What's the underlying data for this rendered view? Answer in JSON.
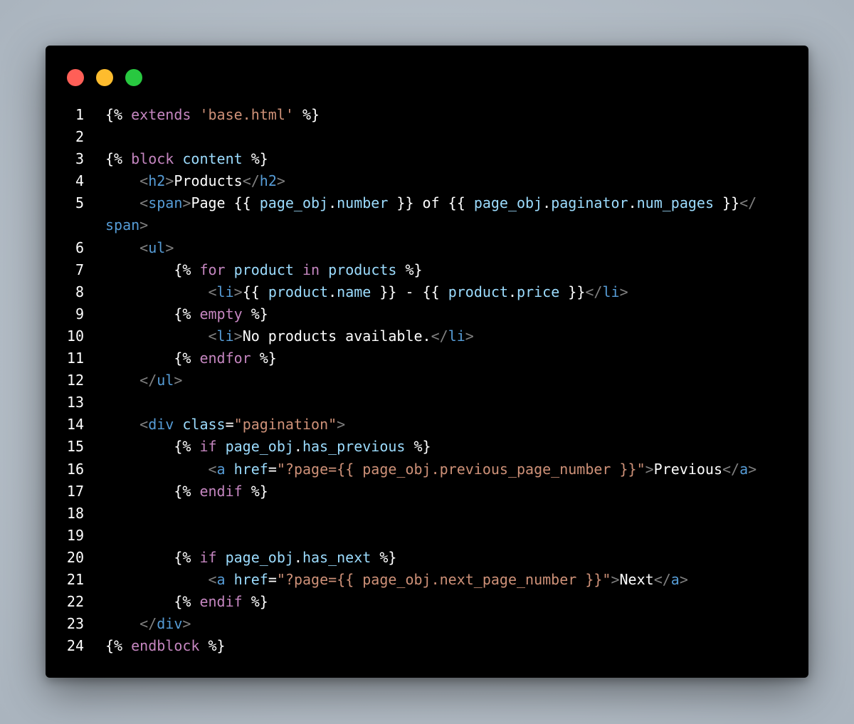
{
  "window": {
    "controls": [
      {
        "name": "close",
        "color": "#ff5f57"
      },
      {
        "name": "minimize",
        "color": "#febc2e"
      },
      {
        "name": "maximize",
        "color": "#28c840"
      }
    ]
  },
  "code": {
    "language": "django-html",
    "colors": {
      "text": "#ffffff",
      "keyword": "#c586c0",
      "string": "#ce9178",
      "variable": "#9cdcfe",
      "tag": "#569cd6",
      "punctuation": "#808080"
    },
    "lines": [
      {
        "number": "1",
        "segments": [
          [
            "w",
            "{% "
          ],
          [
            "kw",
            "extends"
          ],
          [
            "w",
            " "
          ],
          [
            "s",
            "'base.html'"
          ],
          [
            "w",
            " %}"
          ]
        ]
      },
      {
        "number": "2",
        "segments": []
      },
      {
        "number": "3",
        "segments": [
          [
            "w",
            "{% "
          ],
          [
            "kw",
            "block"
          ],
          [
            "w",
            " "
          ],
          [
            "v",
            "content"
          ],
          [
            "w",
            " %}"
          ]
        ]
      },
      {
        "number": "4",
        "segments": [
          [
            "w",
            "    "
          ],
          [
            "g",
            "<"
          ],
          [
            "t",
            "h2"
          ],
          [
            "g",
            ">"
          ],
          [
            "w",
            "Products"
          ],
          [
            "g",
            "</"
          ],
          [
            "t",
            "h2"
          ],
          [
            "g",
            ">"
          ]
        ]
      },
      {
        "number": "5",
        "segments": [
          [
            "w",
            "    "
          ],
          [
            "g",
            "<"
          ],
          [
            "t",
            "span"
          ],
          [
            "g",
            ">"
          ],
          [
            "w",
            "Page {{ "
          ],
          [
            "v",
            "page_obj"
          ],
          [
            "w",
            "."
          ],
          [
            "v",
            "number"
          ],
          [
            "w",
            " }} of {{ "
          ],
          [
            "v",
            "page_obj"
          ],
          [
            "w",
            "."
          ],
          [
            "v",
            "paginator"
          ],
          [
            "w",
            "."
          ],
          [
            "v",
            "num_pages"
          ],
          [
            "w",
            " }}"
          ],
          [
            "g",
            "</"
          ]
        ],
        "continuation": [
          [
            "t",
            "span"
          ],
          [
            "g",
            ">"
          ]
        ]
      },
      {
        "number": "6",
        "segments": [
          [
            "w",
            "    "
          ],
          [
            "g",
            "<"
          ],
          [
            "t",
            "ul"
          ],
          [
            "g",
            ">"
          ]
        ]
      },
      {
        "number": "7",
        "segments": [
          [
            "w",
            "        {% "
          ],
          [
            "kw",
            "for"
          ],
          [
            "w",
            " "
          ],
          [
            "v",
            "product"
          ],
          [
            "w",
            " "
          ],
          [
            "kw",
            "in"
          ],
          [
            "w",
            " "
          ],
          [
            "v",
            "products"
          ],
          [
            "w",
            " %}"
          ]
        ]
      },
      {
        "number": "8",
        "segments": [
          [
            "w",
            "            "
          ],
          [
            "g",
            "<"
          ],
          [
            "t",
            "li"
          ],
          [
            "g",
            ">"
          ],
          [
            "w",
            "{{ "
          ],
          [
            "v",
            "product"
          ],
          [
            "w",
            "."
          ],
          [
            "v",
            "name"
          ],
          [
            "w",
            " }} - {{ "
          ],
          [
            "v",
            "product"
          ],
          [
            "w",
            "."
          ],
          [
            "v",
            "price"
          ],
          [
            "w",
            " }}"
          ],
          [
            "g",
            "</"
          ],
          [
            "t",
            "li"
          ],
          [
            "g",
            ">"
          ]
        ]
      },
      {
        "number": "9",
        "segments": [
          [
            "w",
            "        {% "
          ],
          [
            "kw",
            "empty"
          ],
          [
            "w",
            " %}"
          ]
        ]
      },
      {
        "number": "10",
        "segments": [
          [
            "w",
            "            "
          ],
          [
            "g",
            "<"
          ],
          [
            "t",
            "li"
          ],
          [
            "g",
            ">"
          ],
          [
            "w",
            "No products available."
          ],
          [
            "g",
            "</"
          ],
          [
            "t",
            "li"
          ],
          [
            "g",
            ">"
          ]
        ]
      },
      {
        "number": "11",
        "segments": [
          [
            "w",
            "        {% "
          ],
          [
            "kw",
            "endfor"
          ],
          [
            "w",
            " %}"
          ]
        ]
      },
      {
        "number": "12",
        "segments": [
          [
            "w",
            "    "
          ],
          [
            "g",
            "</"
          ],
          [
            "t",
            "ul"
          ],
          [
            "g",
            ">"
          ]
        ]
      },
      {
        "number": "13",
        "segments": []
      },
      {
        "number": "14",
        "segments": [
          [
            "w",
            "    "
          ],
          [
            "g",
            "<"
          ],
          [
            "t",
            "div"
          ],
          [
            "w",
            " "
          ],
          [
            "v",
            "class"
          ],
          [
            "w",
            "="
          ],
          [
            "s",
            "\"pagination\""
          ],
          [
            "g",
            ">"
          ]
        ]
      },
      {
        "number": "15",
        "segments": [
          [
            "w",
            "        {% "
          ],
          [
            "kw",
            "if"
          ],
          [
            "w",
            " "
          ],
          [
            "v",
            "page_obj"
          ],
          [
            "w",
            "."
          ],
          [
            "v",
            "has_previous"
          ],
          [
            "w",
            " %}"
          ]
        ]
      },
      {
        "number": "16",
        "segments": [
          [
            "w",
            "            "
          ],
          [
            "g",
            "<"
          ],
          [
            "t",
            "a"
          ],
          [
            "w",
            " "
          ],
          [
            "v",
            "href"
          ],
          [
            "w",
            "="
          ],
          [
            "s",
            "\"?page={{ page_obj.previous_page_number }}\""
          ],
          [
            "g",
            ">"
          ],
          [
            "w",
            "Previous"
          ],
          [
            "g",
            "</"
          ],
          [
            "t",
            "a"
          ],
          [
            "g",
            ">"
          ]
        ]
      },
      {
        "number": "17",
        "segments": [
          [
            "w",
            "        {% "
          ],
          [
            "kw",
            "endif"
          ],
          [
            "w",
            " %}"
          ]
        ]
      },
      {
        "number": "18",
        "segments": []
      },
      {
        "number": "19",
        "segments": []
      },
      {
        "number": "20",
        "segments": [
          [
            "w",
            "        {% "
          ],
          [
            "kw",
            "if"
          ],
          [
            "w",
            " "
          ],
          [
            "v",
            "page_obj"
          ],
          [
            "w",
            "."
          ],
          [
            "v",
            "has_next"
          ],
          [
            "w",
            " %}"
          ]
        ]
      },
      {
        "number": "21",
        "segments": [
          [
            "w",
            "            "
          ],
          [
            "g",
            "<"
          ],
          [
            "t",
            "a"
          ],
          [
            "w",
            " "
          ],
          [
            "v",
            "href"
          ],
          [
            "w",
            "="
          ],
          [
            "s",
            "\"?page={{ page_obj.next_page_number }}\""
          ],
          [
            "g",
            ">"
          ],
          [
            "w",
            "Next"
          ],
          [
            "g",
            "</"
          ],
          [
            "t",
            "a"
          ],
          [
            "g",
            ">"
          ]
        ]
      },
      {
        "number": "22",
        "segments": [
          [
            "w",
            "        {% "
          ],
          [
            "kw",
            "endif"
          ],
          [
            "w",
            " %}"
          ]
        ]
      },
      {
        "number": "23",
        "segments": [
          [
            "w",
            "    "
          ],
          [
            "g",
            "</"
          ],
          [
            "t",
            "div"
          ],
          [
            "g",
            ">"
          ]
        ]
      },
      {
        "number": "24",
        "segments": [
          [
            "w",
            "{% "
          ],
          [
            "kw",
            "endblock"
          ],
          [
            "w",
            " %}"
          ]
        ]
      }
    ]
  }
}
